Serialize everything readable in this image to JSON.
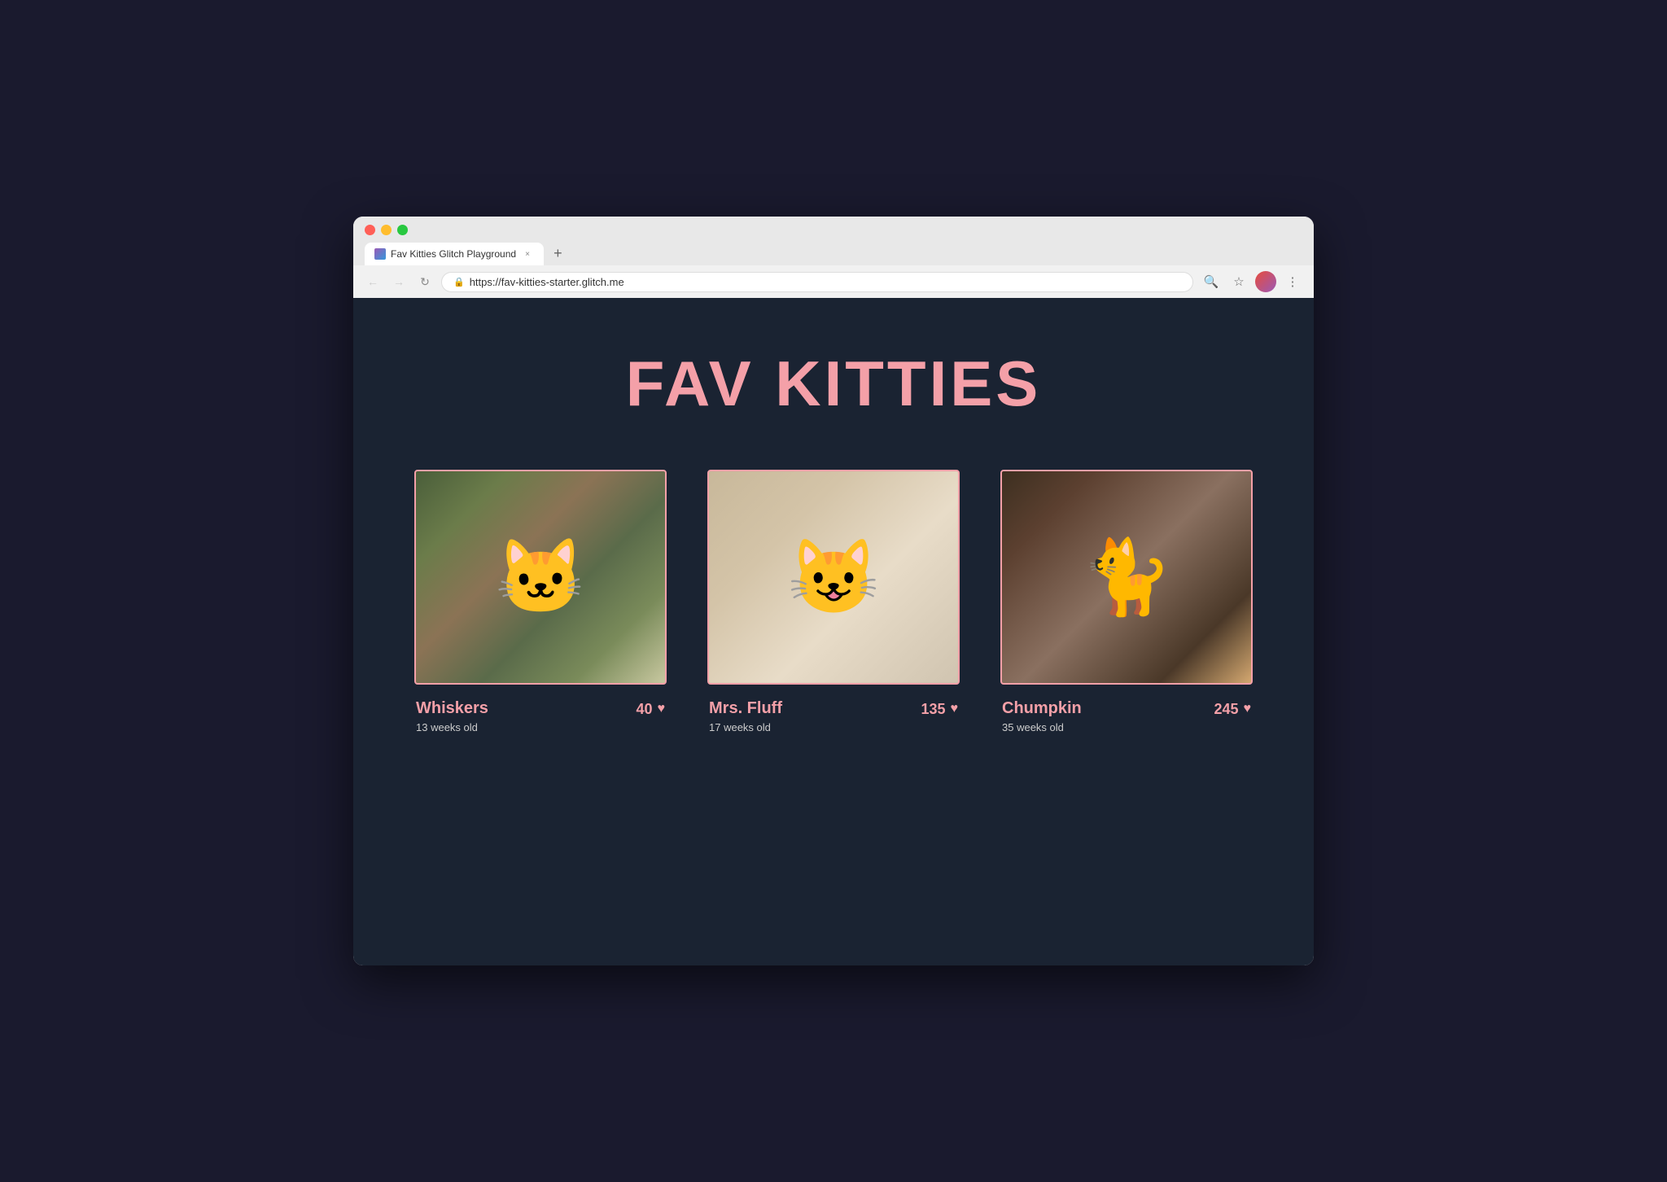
{
  "browser": {
    "tab_title": "Fav Kitties Glitch Playground",
    "tab_close": "×",
    "tab_new": "+",
    "address": "https://fav-kitties-starter.glitch.me",
    "back_btn": "←",
    "forward_btn": "→",
    "reload_btn": "↻"
  },
  "site": {
    "title": "FAV KITTIES",
    "accent_color": "#f4a0a8",
    "bg_color": "#1a2332"
  },
  "kitties": [
    {
      "name": "Whiskers",
      "age": "13 weeks old",
      "votes": "40",
      "image_type": "cat-1-bg",
      "id": "whiskers"
    },
    {
      "name": "Mrs. Fluff",
      "age": "17 weeks old",
      "votes": "135",
      "image_type": "cat-2-bg",
      "id": "mrs-fluff"
    },
    {
      "name": "Chumpkin",
      "age": "35 weeks old",
      "votes": "245",
      "image_type": "cat-3-bg",
      "id": "chumpkin"
    }
  ],
  "icons": {
    "lock": "🔒",
    "search": "🔍",
    "star": "☆",
    "menu": "⋮",
    "heart": "♥"
  }
}
